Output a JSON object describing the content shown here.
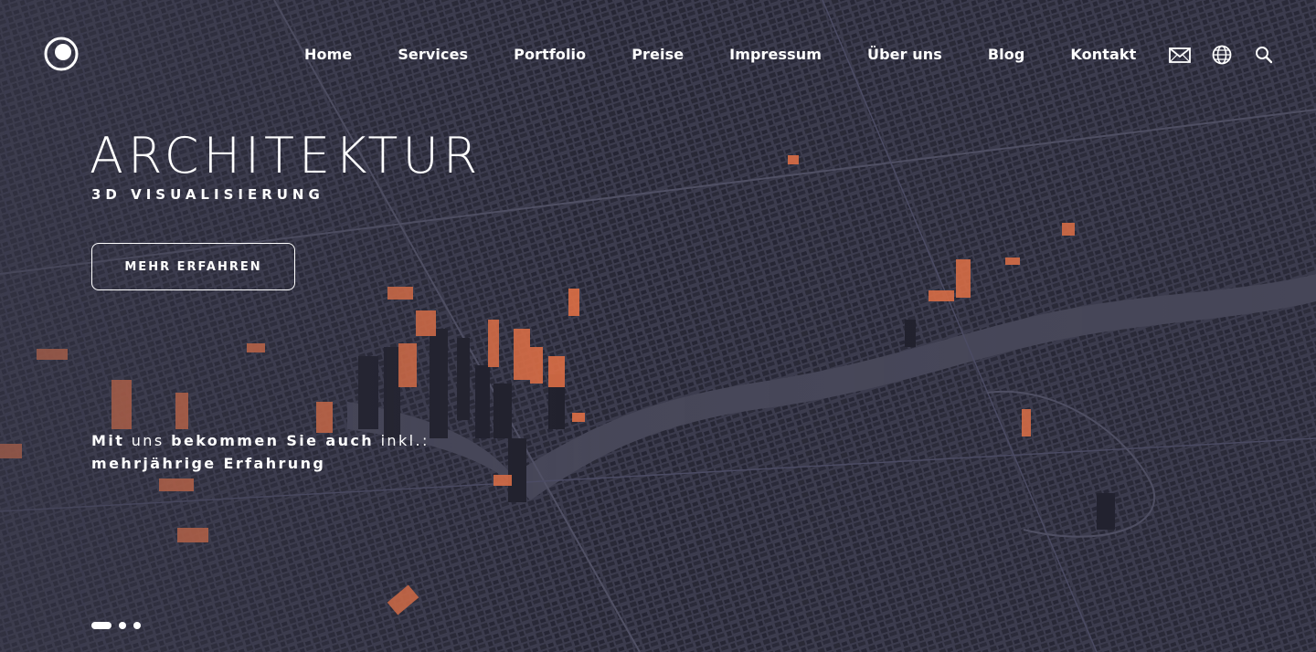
{
  "colors": {
    "overlay": "#3b3b4c",
    "highlight": "#ff7a45",
    "text": "#ffffff"
  },
  "brand": {
    "logo_icon": "circle-logo-icon"
  },
  "nav": {
    "items": [
      {
        "label": "Home"
      },
      {
        "label": "Services"
      },
      {
        "label": "Portfolio"
      },
      {
        "label": "Preise"
      },
      {
        "label": "Impressum"
      },
      {
        "label": "Über uns"
      },
      {
        "label": "Blog"
      },
      {
        "label": "Kontakt"
      }
    ]
  },
  "utilities": {
    "icons": [
      "mail-icon",
      "globe-icon",
      "search-icon"
    ]
  },
  "hero": {
    "title": "ARCHITEKTUR",
    "subtitle": "3D VISUALISIERUNG",
    "cta_label": "MEHR ERFAHREN",
    "tagline": {
      "word1": "Mit",
      "word2": "uns",
      "word3": "bekommen Sie auch",
      "word4": "inkl.:",
      "line2": "mehrjährige Erfahrung"
    }
  },
  "slider": {
    "count": 3,
    "active_index": 0
  }
}
